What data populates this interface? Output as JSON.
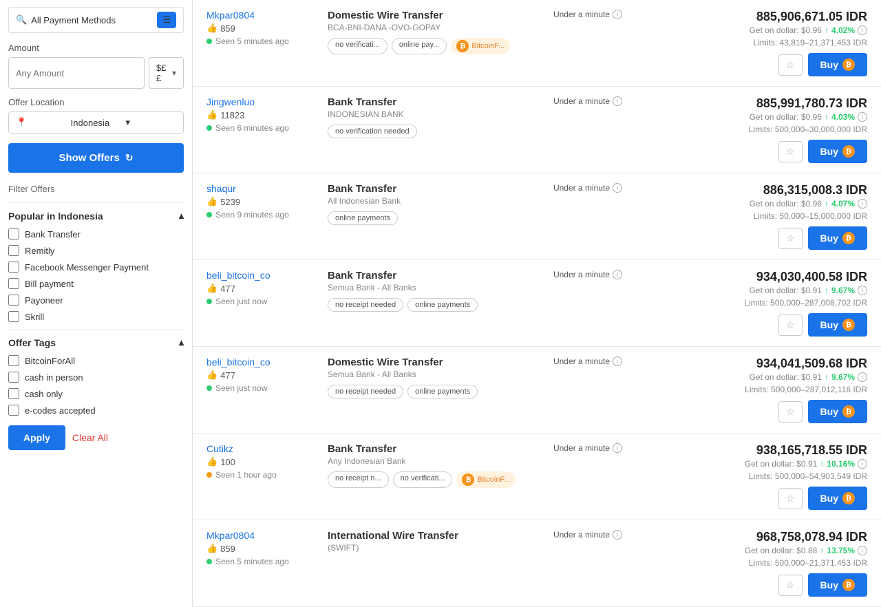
{
  "sidebar": {
    "payment_method_label": "All Payment Methods",
    "amount_section_label": "Amount",
    "amount_placeholder": "Any Amount",
    "currency_value": "$££",
    "location_section_label": "Offer Location",
    "location_value": "Indonesia",
    "show_offers_label": "Show Offers",
    "filter_offers_label": "Filter Offers",
    "popular_section_label": "Popular in Indonesia",
    "popular_items": [
      {
        "id": "bank-transfer",
        "label": "Bank Transfer",
        "checked": false
      },
      {
        "id": "remitly",
        "label": "Remitly",
        "checked": false
      },
      {
        "id": "facebook-messenger",
        "label": "Facebook Messenger Payment",
        "checked": false
      },
      {
        "id": "bill-payment",
        "label": "Bill payment",
        "checked": false
      },
      {
        "id": "payoneer",
        "label": "Payoneer",
        "checked": false
      },
      {
        "id": "skrill",
        "label": "Skrill",
        "checked": false
      }
    ],
    "offer_tags_label": "Offer Tags",
    "tag_items": [
      {
        "id": "bitcoinforall",
        "label": "BitcoinForAll",
        "checked": false
      },
      {
        "id": "cash-in-person",
        "label": "cash in person",
        "checked": false
      },
      {
        "id": "cash-only",
        "label": "cash only",
        "checked": false
      },
      {
        "id": "e-codes-accepted",
        "label": "e-codes accepted",
        "checked": false
      }
    ],
    "apply_label": "Apply",
    "clear_all_label": "Clear All"
  },
  "offers": [
    {
      "seller": "Mkpar0804",
      "likes": "859",
      "seen": "Seen 5 minutes ago",
      "dot_color": "green",
      "method": "Domestic Wire Transfer",
      "detail": "BCA-BNI-DANA -OVO-GOPAY",
      "speed": "Under a minute",
      "price": "885,906,671.05 IDR",
      "get_on_dollar": "Get on dollar: $0.96",
      "percent": "4.02%",
      "limits": "Limits: 43,819–21,371,453 IDR",
      "tags": [
        {
          "type": "normal",
          "text": "no verificati..."
        },
        {
          "type": "normal",
          "text": "online pay..."
        },
        {
          "type": "bitcoin",
          "text": "BitcoinF..."
        }
      ]
    },
    {
      "seller": "Jingwenluo",
      "likes": "11823",
      "seen": "Seen 6 minutes ago",
      "dot_color": "green",
      "method": "Bank Transfer",
      "detail": "INDONESIAN BANK",
      "speed": "Under a minute",
      "price": "885,991,780.73 IDR",
      "get_on_dollar": "Get on dollar: $0.96",
      "percent": "4.03%",
      "limits": "Limits: 500,000–30,000,000 IDR",
      "tags": [
        {
          "type": "normal",
          "text": "no verification needed"
        }
      ]
    },
    {
      "seller": "shaqur",
      "likes": "5239",
      "seen": "Seen 9 minutes ago",
      "dot_color": "green",
      "method": "Bank Transfer",
      "detail": "All Indonesian Bank",
      "speed": "Under a minute",
      "price": "886,315,008.3 IDR",
      "get_on_dollar": "Get on dollar: $0.96",
      "percent": "4.07%",
      "limits": "Limits: 50,000–15,000,000 IDR",
      "tags": [
        {
          "type": "normal",
          "text": "online payments"
        }
      ]
    },
    {
      "seller": "beli_bitcoin_co",
      "likes": "477",
      "seen": "Seen just now",
      "dot_color": "green",
      "method": "Bank Transfer",
      "detail": "Semua Bank - All Banks",
      "speed": "Under a minute",
      "price": "934,030,400.58 IDR",
      "get_on_dollar": "Get on dollar: $0.91",
      "percent": "9.67%",
      "limits": "Limits: 500,000–287,008,702 IDR",
      "tags": [
        {
          "type": "normal",
          "text": "no receipt needed"
        },
        {
          "type": "normal",
          "text": "online payments"
        }
      ]
    },
    {
      "seller": "beli_bitcoin_co",
      "likes": "477",
      "seen": "Seen just now",
      "dot_color": "green",
      "method": "Domestic Wire Transfer",
      "detail": "Semua Bank - All Banks",
      "speed": "Under a minute",
      "price": "934,041,509.68 IDR",
      "get_on_dollar": "Get on dollar: $0.91",
      "percent": "9.67%",
      "limits": "Limits: 500,000–287,012,116 IDR",
      "tags": [
        {
          "type": "normal",
          "text": "no receipt needed"
        },
        {
          "type": "normal",
          "text": "online payments"
        }
      ]
    },
    {
      "seller": "Cutikz",
      "likes": "100",
      "seen": "Seen 1 hour ago",
      "dot_color": "yellow",
      "method": "Bank Transfer",
      "detail": "Any Indonesian Bank",
      "speed": "Under a minute",
      "price": "938,165,718.55 IDR",
      "get_on_dollar": "Get on dollar: $0.91",
      "percent": "10.16%",
      "limits": "Limits: 500,000–54,903,549 IDR",
      "tags": [
        {
          "type": "normal",
          "text": "no receipt n..."
        },
        {
          "type": "normal",
          "text": "no verificati..."
        },
        {
          "type": "bitcoin",
          "text": "BitcoinF..."
        }
      ]
    },
    {
      "seller": "Mkpar0804",
      "likes": "859",
      "seen": "Seen 5 minutes ago",
      "dot_color": "green",
      "method": "International Wire Transfer",
      "detail": "(SWIFT)",
      "speed": "Under a minute",
      "price": "968,758,078.94 IDR",
      "get_on_dollar": "Get on dollar: $0.88",
      "percent": "13.75%",
      "limits": "Limits: 500,000–21,371,453 IDR",
      "tags": []
    }
  ]
}
